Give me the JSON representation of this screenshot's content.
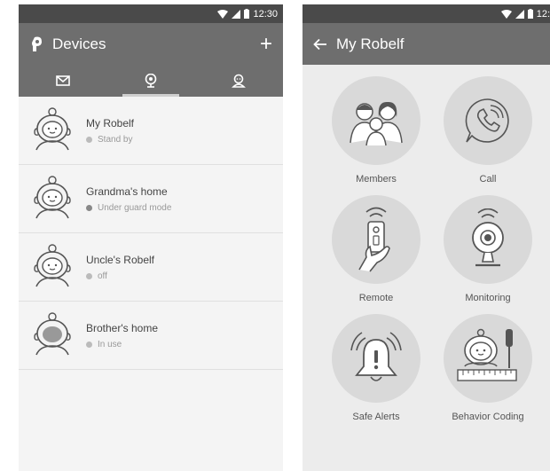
{
  "left": {
    "status_time": "12:30",
    "title": "Devices",
    "add_label": "+",
    "tabs": [
      {
        "icon": "mail-icon"
      },
      {
        "icon": "webcam-icon"
      },
      {
        "icon": "contact-icon"
      }
    ],
    "devices": [
      {
        "name": "My Robelf",
        "status": "Stand by",
        "icon": "robot-icon"
      },
      {
        "name": "Grandma's home",
        "status": "Under guard mode",
        "icon": "robot-icon"
      },
      {
        "name": "Uncle's Robelf",
        "status": "off",
        "icon": "robot-icon"
      },
      {
        "name": "Brother's home",
        "status": "In use",
        "icon": "robot-icon"
      }
    ]
  },
  "right": {
    "status_time": "12:",
    "title": "My Robelf",
    "features": [
      {
        "label": "Members",
        "icon": "family-icon"
      },
      {
        "label": "Call",
        "icon": "phone-icon"
      },
      {
        "label": "Remote",
        "icon": "remote-icon"
      },
      {
        "label": "Monitoring",
        "icon": "webcam-icon"
      },
      {
        "label": "Safe Alerts",
        "icon": "bell-alert-icon"
      },
      {
        "label": "Behavior Coding",
        "icon": "robot-coding-icon"
      }
    ]
  }
}
